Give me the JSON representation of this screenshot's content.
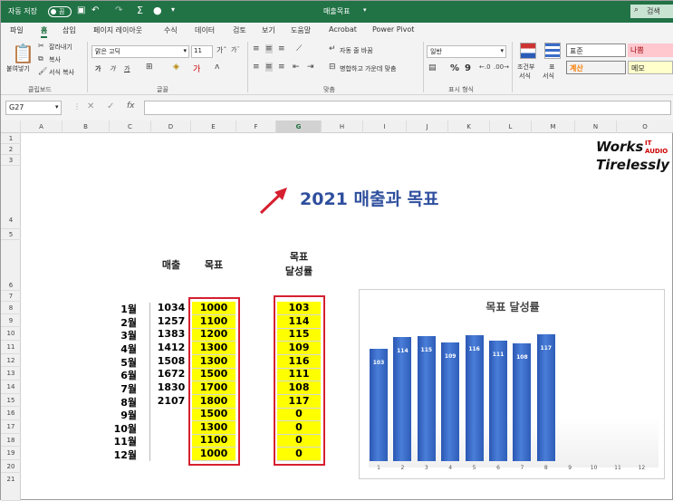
{
  "titlebar": {
    "autosave": "자동 저장",
    "autosave_state": "끔",
    "doc_title": "매출목표",
    "search_hint": "검색"
  },
  "tabs": [
    "파일",
    "홈",
    "삽입",
    "페이지 레이아웃",
    "수식",
    "데이터",
    "검토",
    "보기",
    "도움말",
    "Acrobat",
    "Power Pivot"
  ],
  "active_tab": "홈",
  "clipboard": {
    "paste": "붙여넣기",
    "cut": "잘라내기",
    "copy": "복사",
    "format_painter": "서식 복사",
    "group": "클립보드"
  },
  "font": {
    "name": "맑은 고딕",
    "size": "11",
    "bold": "가",
    "italic": "가",
    "underline": "가",
    "group": "글꼴"
  },
  "align": {
    "wrap": "자동 줄 바꿈",
    "merge": "병합하고 가운데 맞춤",
    "group": "맞춤"
  },
  "number": {
    "format": "일반",
    "percent": "%",
    "comma": "9",
    "group": "표시 형식"
  },
  "styles": {
    "cond": "조건부",
    "cond2": "서식",
    "table": "표",
    "table2": "서식",
    "normal": "표준",
    "bad": "나쁨",
    "calc": "계산",
    "memo": "메모"
  },
  "formula": {
    "cell": "G27",
    "fx": "fx"
  },
  "columns": [
    "A",
    "B",
    "C",
    "D",
    "E",
    "F",
    "G",
    "H",
    "I",
    "J",
    "K",
    "L",
    "M",
    "N",
    "O"
  ],
  "rows": [
    "1",
    "2",
    "3",
    "4",
    "5",
    "6",
    "7",
    "8",
    "9",
    "10",
    "11",
    "12",
    "13",
    "14",
    "15",
    "16",
    "17",
    "18",
    "19",
    "20",
    "21"
  ],
  "sheet": {
    "title": "2021 매출과 목표",
    "hdr_sales": "매출",
    "hdr_target": "목표",
    "hdr_rate1": "목표",
    "hdr_rate2": "달성률",
    "months": [
      "1월",
      "2월",
      "3월",
      "4월",
      "5월",
      "6월",
      "7월",
      "8월",
      "9월",
      "10월",
      "11월",
      "12월"
    ],
    "sales": [
      "1034",
      "1257",
      "1383",
      "1412",
      "1508",
      "1672",
      "1830",
      "2107",
      "",
      "",
      "",
      ""
    ],
    "targets": [
      "1000",
      "1100",
      "1200",
      "1300",
      "1300",
      "1500",
      "1700",
      "1800",
      "1500",
      "1300",
      "1100",
      "1000"
    ],
    "rates": [
      "103",
      "114",
      "115",
      "109",
      "116",
      "111",
      "108",
      "117",
      "0",
      "0",
      "0",
      "0"
    ]
  },
  "logo": {
    "line1": "Works",
    "line2": "Tirelessly",
    "tag1": "IT",
    "tag2": "AUDIO"
  },
  "chart_data": {
    "type": "bar",
    "title": "목표 달성률",
    "categories": [
      "1",
      "2",
      "3",
      "4",
      "5",
      "6",
      "7",
      "8",
      "9",
      "10",
      "11",
      "12"
    ],
    "values": [
      103,
      114,
      115,
      109,
      116,
      111,
      108,
      117,
      0,
      0,
      0,
      0
    ]
  },
  "colors": {
    "excel_green": "#217346",
    "highlight": "#ffff00",
    "box_red": "#d62030",
    "title_blue": "#2f4f9e",
    "bar_blue": "#3a6cc8"
  }
}
